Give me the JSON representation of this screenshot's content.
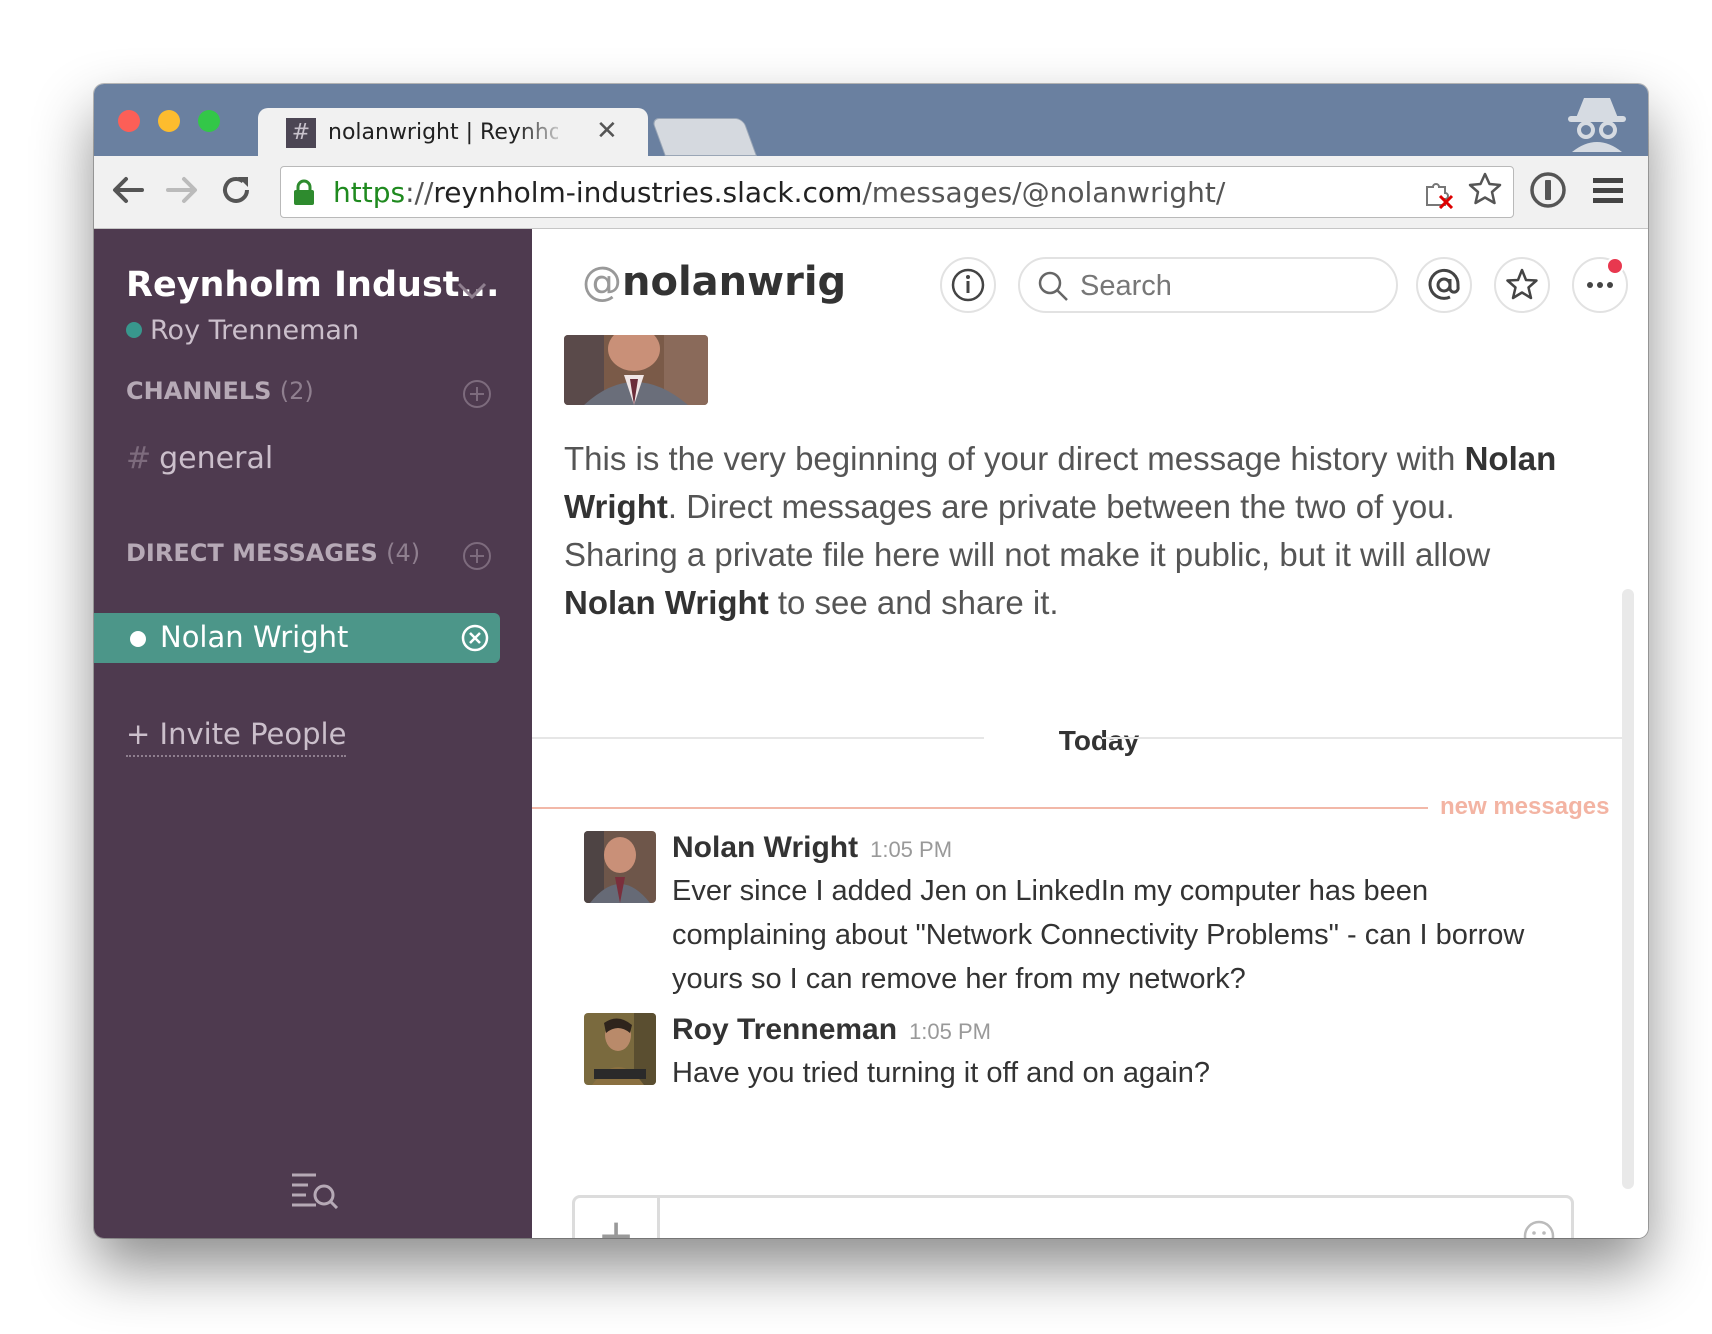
{
  "browser": {
    "tab_favicon": "#",
    "tab_title": "nolanwright | Reynholm Industries Slack",
    "tab_close": "✕",
    "url_scheme": "https",
    "url_sep": "://",
    "url_host": "reynholm-industries.slack.com",
    "url_path": "/messages/@nolanwright/"
  },
  "sidebar": {
    "team_name": "Reynholm Indust...",
    "user_name": "Roy Trenneman",
    "channels_label": "CHANNELS",
    "channels_count": "(2)",
    "channels": [
      {
        "name": "general"
      }
    ],
    "dm_label": "DIRECT MESSAGES",
    "dm_count": "(4)",
    "direct_messages": [
      {
        "name": "Nolan Wright",
        "active": true
      }
    ],
    "invite_label": "+ Invite People"
  },
  "header": {
    "at": "@",
    "channel_name": "nolanwrig",
    "search_placeholder": "Search"
  },
  "intro": {
    "part1": "This is the very beginning of your direct message history with ",
    "name1": "Nolan Wright",
    "part2": ". Direct messages are private between the two of you. Sharing a private file here will not make it public, but it will allow ",
    "name2": "Nolan Wright",
    "part3": " to see and share it."
  },
  "day_divider": "Today",
  "new_messages_label": "new messages",
  "messages": [
    {
      "author": "Nolan Wright",
      "time": "1:05 PM",
      "text": "Ever since I added Jen on LinkedIn my computer has been complaining about \"Network Connectivity Problems\" - can I borrow yours so I can remove her from my network?"
    },
    {
      "author": "Roy Trenneman",
      "time": "1:05 PM",
      "text": "Have you tried turning it off and on again?"
    }
  ],
  "composer": {
    "plus": "+",
    "placeholder": ""
  },
  "icons": {
    "back": "back-arrow-icon",
    "forward": "forward-arrow-icon",
    "reload": "reload-icon",
    "lock": "lock-icon",
    "star": "star-icon",
    "menu": "hamburger-menu-icon",
    "info": "info-icon",
    "search": "search-icon",
    "mentions": "at-icon",
    "more": "ellipsis-icon",
    "emoji": "smiley-icon",
    "quick_switcher": "quick-switcher-icon"
  },
  "colors": {
    "sidebar_bg": "#4e3a4f",
    "active_item": "#4c9689",
    "presence": "#38978d",
    "new_messages": "#f3b4a3",
    "notification": "#e8384f"
  }
}
